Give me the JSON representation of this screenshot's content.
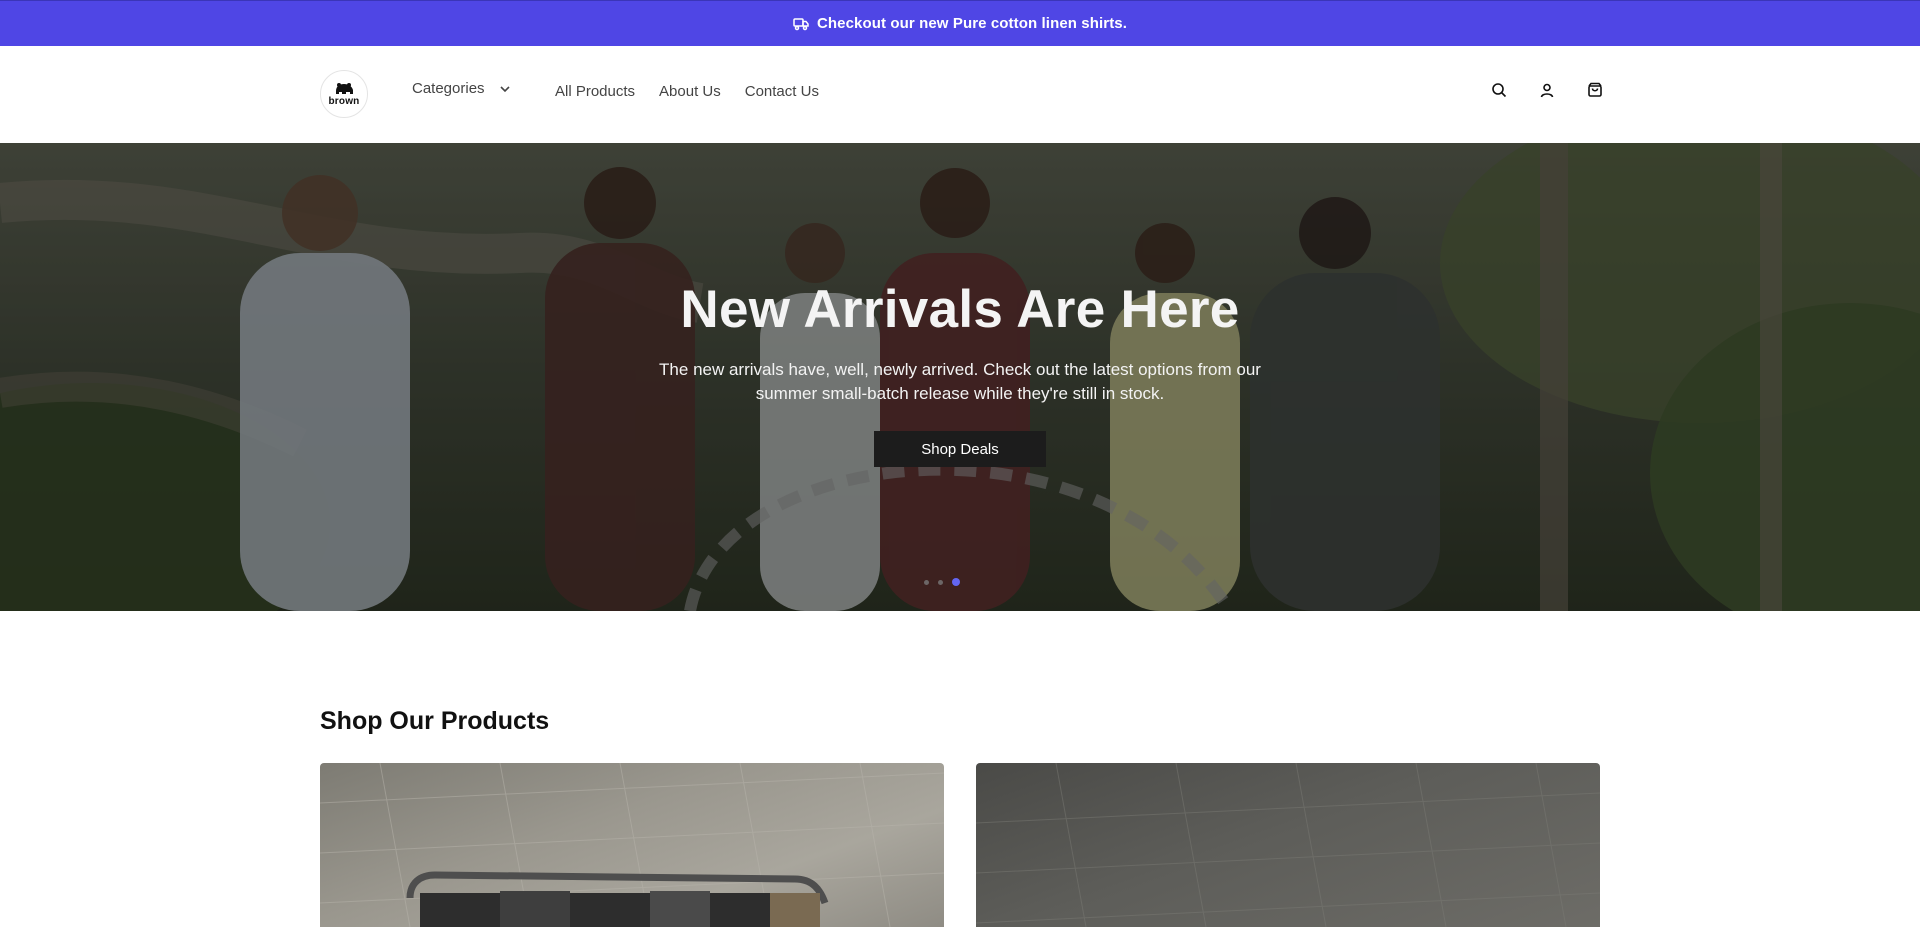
{
  "announcement": {
    "icon": "truck-icon",
    "text": "Checkout our new Pure cotton linen shirts."
  },
  "header": {
    "logo_text": "brown",
    "categories_label": "Categories",
    "nav": [
      {
        "label": "All Products"
      },
      {
        "label": "About Us"
      },
      {
        "label": "Contact Us"
      }
    ],
    "icons": [
      "search-icon",
      "user-icon",
      "shopping-bag-icon"
    ]
  },
  "hero": {
    "title": "New Arrivals Are Here",
    "description": "The new arrivals have, well, newly arrived. Check out the latest options from our summer small-batch release while they're still in stock.",
    "button_label": "Shop Deals",
    "slides_total": 3,
    "active_slide": 3
  },
  "products_section": {
    "title": "Shop Our Products"
  },
  "colors": {
    "accent": "#4f46e5",
    "button_dark": "#1c1c1c",
    "text_dark": "#111111"
  }
}
